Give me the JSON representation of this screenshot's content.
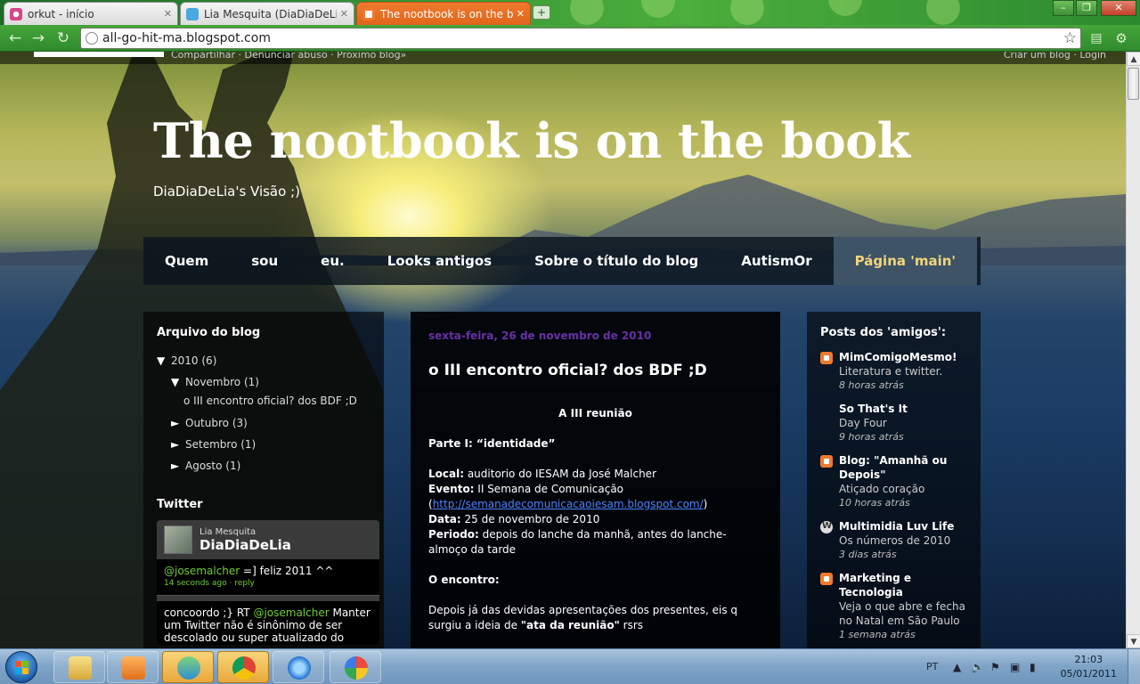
{
  "browser": {
    "tabs": [
      {
        "label": "orkut - início",
        "icon": "orkut-icon"
      },
      {
        "label": "Lia Mesquita (DiaDiaDeLi…",
        "icon": "twitter-icon"
      },
      {
        "label": "The nootbook is on the b…",
        "icon": "blogger-icon"
      }
    ],
    "new_tab": "+",
    "url": "all-go-hit-ma.blogspot.com"
  },
  "blog": {
    "title": "The nootbook is on the book",
    "description": "DiaDiaDeLia's Visão ;)",
    "top_bar_left": "Compartilhar · Denunciar abuso · Próximo blog»",
    "top_bar_right": "Criar um blog · Login"
  },
  "nav": {
    "items": [
      "Quem",
      "sou",
      "eu.",
      "Looks antigos",
      "Sobre o título do blog",
      "AutismOr",
      "Página 'main'"
    ]
  },
  "archive": {
    "title": "Arquivo do blog",
    "year": {
      "label": "2010",
      "count": "(6)"
    },
    "november": {
      "label": "Novembro",
      "count": "(1)"
    },
    "post_link": "o III encontro oficial? dos BDF ;D",
    "october": {
      "label": "Outubro",
      "count": "(3)"
    },
    "september": {
      "label": "Setembro",
      "count": "(1)"
    },
    "august": {
      "label": "Agosto",
      "count": "(1)"
    }
  },
  "twitter": {
    "title": "Twitter",
    "name": "Lia Mesquita",
    "handle": "DiaDiaDeLia",
    "tweet1": {
      "mention": "@josemalcher",
      "text": " =] feliz 2011 ^^",
      "meta": "14 seconds ago · reply"
    },
    "tweet2": {
      "prefix": "concoordo ;} RT ",
      "mention": "@josemalcher",
      "text": " Manter um Twitter não é sinônimo de ser descolado ou super atualizado do mundo,"
    }
  },
  "post": {
    "date": "sexta-feira, 26 de novembro de 2010",
    "title": "o III encontro oficial? dos BDF ;D",
    "heading": "A III reunião",
    "part1": "Parte I: “identidade”",
    "local_label": "Local:",
    "local_value": " auditorio do IESAM da José Malcher",
    "evento_label": "Evento:",
    "evento_value": " II Semana de Comunicação",
    "link": "http://semanadecomunicacaoiesam.blogspot.com/",
    "data_label": "Data:",
    "data_value": " 25 de novembro de 2010",
    "periodo_label": "Periodo:",
    "periodo_value": " depois do lanche da manhã, antes do lanche-almoço da tarde",
    "encontro": "O encontro:",
    "body_1": "Depois já das devidas apresentações dos presentes, eis q surgiu a ideia de ",
    "body_bold": "\"ata da reunião\"",
    "body_2": " rsrs"
  },
  "friends": {
    "title": "Posts dos 'amigos':",
    "items": [
      {
        "title": "MimComigoMesmo!",
        "sub": "Literatura e twitter.",
        "time": "8 horas atrás"
      },
      {
        "title": "So That's It",
        "sub": "Day Four",
        "time": "9 horas atrás"
      },
      {
        "title": "Blog: \"Amanhã ou Depois\"",
        "sub": "Atiçado coração",
        "time": "10 horas atrás"
      },
      {
        "title": "Multimidia Luv Life",
        "sub": "Os números de 2010",
        "time": "3 dias atrás"
      },
      {
        "title": "Marketing e Tecnologia",
        "sub": "Veja o que abre e fecha no Natal em São Paulo",
        "time": "1 semana atrás"
      }
    ]
  },
  "taskbar": {
    "lang": "PT",
    "time": "21:03",
    "date": "05/01/2011"
  }
}
